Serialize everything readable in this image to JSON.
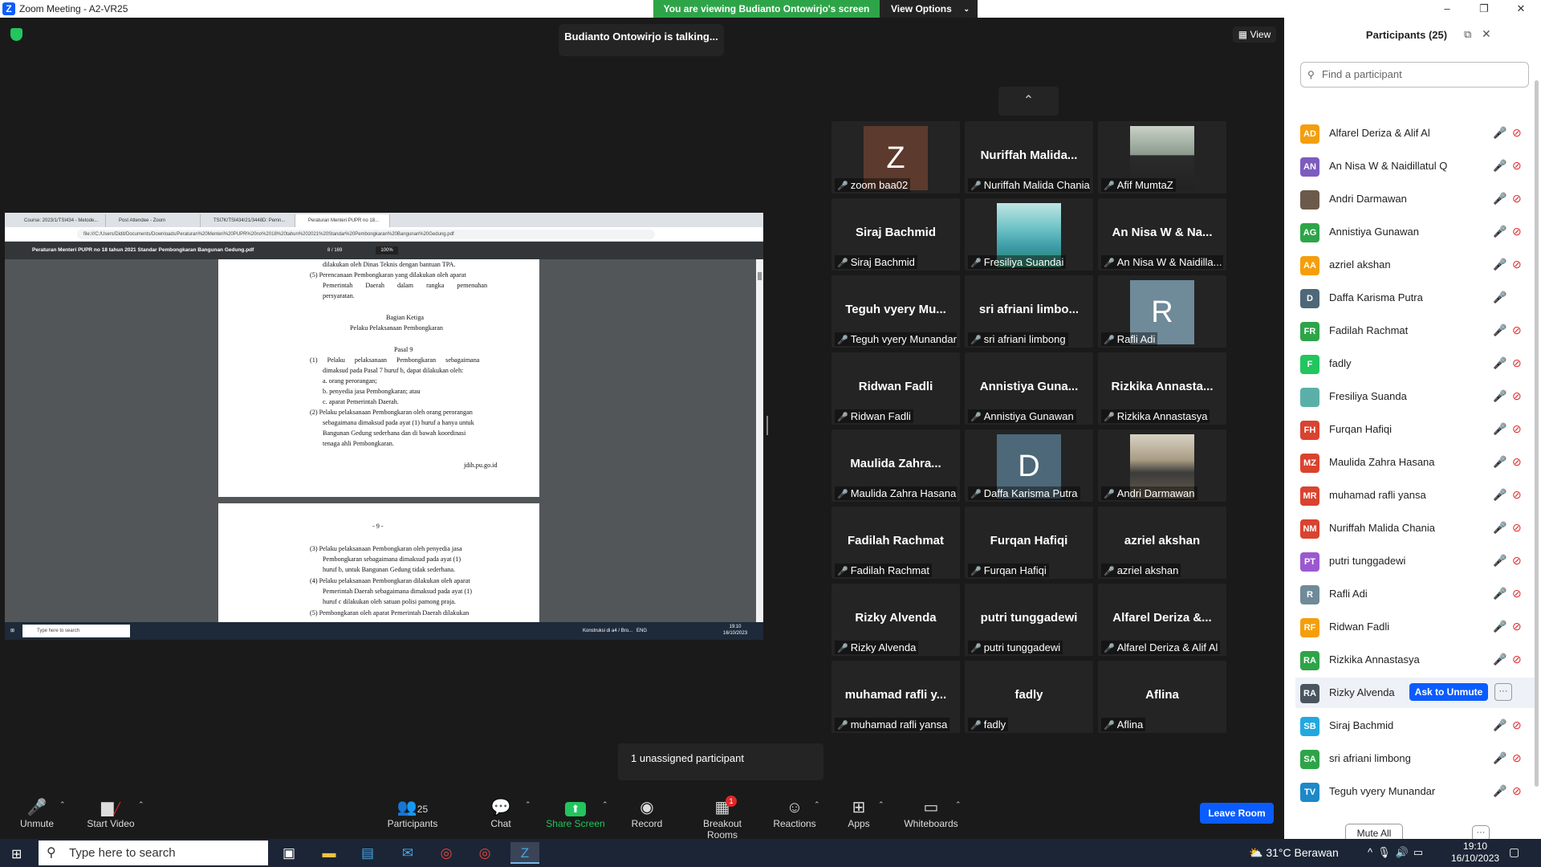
{
  "window": {
    "app_title": "Zoom Meeting - A2-VR25",
    "minimize": "–",
    "maximize": "❐",
    "close": "✕"
  },
  "banner": {
    "viewing": "You are viewing Budianto Ontowirjo's screen",
    "view_options": "View Options"
  },
  "talking": "Budianto Ontowirjo is talking...",
  "view_button": "View",
  "shared_screen": {
    "tabs": [
      "Course: 2023/1/TSI434 - Metode...",
      "Post Attendee - Zoom",
      "TSI7K/TSI434/21/3448D: Pemn...",
      "Peraturan Menteri PUPR no 18..."
    ],
    "url": "file:///C:/Users/Didit/Documents/Downloads/Peraturan%20Menteri%20PUPR%20no%2018%20tahun%202021%20Standar%20Pembongkaran%20Bangunan%20Gedung.pdf",
    "pdf_title": "Peraturan Menteri PUPR no 18 tahun 2021 Standar Pembongkaran Bangunan Gedung.pdf",
    "page_current": "8",
    "page_total": "/ 169",
    "zoom": "100%",
    "page1_lines": [
      "dilakukan oleh Dinas Teknis dengan bantuan TPA.",
      "(5)  Perencanaan Pembongkaran yang dilakukan oleh aparat",
      "Pemerintah Daerah dalam rangka pemenuhan",
      "persyaratan.",
      "Bagian Ketiga",
      "Pelaku Pelaksanaan Pembongkaran",
      "Pasal 9",
      "(1)  Pelaku pelaksanaan Pembongkaran sebagaimana",
      "dimaksud pada Pasal 7 huruf b, dapat dilakukan oleh:",
      "a.  orang perorangan;",
      "b.  penyedia jasa Pembongkaran; atau",
      "c.  aparat Pemerintah Daerah.",
      "(2)  Pelaku pelaksanaan Pembongkaran oleh orang perorangan",
      "sebagaimana dimaksud pada ayat (1) huruf a hanya untuk",
      "Bangunan Gedung sederhana dan di bawah koordinasi",
      "tenaga ahli Pembongkaran.",
      "jdih.pu.go.id"
    ],
    "page2_lines": [
      "- 9 -",
      "(3)  Pelaku pelaksanaan Pembongkaran oleh penyedia jasa",
      "Pembongkaran sebagaimana dimaksud pada ayat (1)",
      "huruf b, untuk Bangunan Gedung tidak sederhana.",
      "(4)  Pelaku pelaksanaan Pembongkaran dilakukan oleh aparat",
      "Pemerintah Daerah sebagaimana dimaksud pada ayat (1)",
      "huruf c dilakukan oleh satuan polisi pamong praja.",
      "(5)  Pembongkaran oleh aparat Pemerintah Daerah dilakukan"
    ],
    "inner_search": "Type here to search",
    "inner_tray": "Konstruksi di a4 / Bro...",
    "inner_lang": "ENG",
    "inner_time": "19:10",
    "inner_date": "16/10/2023"
  },
  "gallery": [
    {
      "big": "",
      "avatar": "Z",
      "avatar_color": "#5c3a2e",
      "label": "zoom baa02"
    },
    {
      "big": "Nuriffah Malida...",
      "label": "Nuriffah Malida Chania"
    },
    {
      "big": "",
      "photo": "person",
      "label": "Afif MumtaZ"
    },
    {
      "big": "Siraj Bachmid",
      "label": "Siraj Bachmid"
    },
    {
      "big": "",
      "photo": "waterfall",
      "label": "Fresiliya Suandai"
    },
    {
      "big": "An Nisa W & Na...",
      "label": "An Nisa W & Naidilla..."
    },
    {
      "big": "Teguh vyery Mu...",
      "label": "Teguh vyery Munandar"
    },
    {
      "big": "sri afriani limbo...",
      "label": "sri afriani limbong"
    },
    {
      "big": "",
      "avatar": "R",
      "avatar_color": "#6f8a99",
      "label": "Rafli Adi"
    },
    {
      "big": "Ridwan Fadli",
      "label": "Ridwan Fadli"
    },
    {
      "big": "Annistiya Guna...",
      "label": "Annistiya Gunawan"
    },
    {
      "big": "Rizkika Annasta...",
      "label": "Rizkika Annastasya"
    },
    {
      "big": "Maulida Zahra...",
      "label": "Maulida Zahra Hasana"
    },
    {
      "big": "",
      "avatar": "D",
      "avatar_color": "#4d6878",
      "label": "Daffa Karisma Putra"
    },
    {
      "big": "",
      "photo": "outdoor",
      "label": "Andri Darmawan"
    },
    {
      "big": "Fadilah Rachmat",
      "label": "Fadilah Rachmat"
    },
    {
      "big": "Furqan Hafiqi",
      "label": "Furqan Hafiqi"
    },
    {
      "big": "azriel akshan",
      "label": "azriel akshan"
    },
    {
      "big": "Rizky Alvenda",
      "label": "Rizky Alvenda"
    },
    {
      "big": "putri tunggadewi",
      "label": "putri tunggadewi"
    },
    {
      "big": "Alfarel Deriza &...",
      "label": "Alfarel Deriza & Alif Al"
    },
    {
      "big": "muhamad rafli y...",
      "label": "muhamad rafli yansa"
    },
    {
      "big": "fadly",
      "label": "fadly"
    },
    {
      "big": "Aflina",
      "label": "Aflina"
    }
  ],
  "unassigned": "1 unassigned participant",
  "toolbar": {
    "unmute": "Unmute",
    "start_video": "Start Video",
    "participants": "Participants",
    "participants_count": "25",
    "chat": "Chat",
    "share_screen": "Share Screen",
    "record": "Record",
    "breakout_rooms": "Breakout Rooms",
    "breakout_badge": "1",
    "reactions": "Reactions",
    "apps": "Apps",
    "whiteboards": "Whiteboards",
    "leave_room": "Leave Room"
  },
  "panel": {
    "title": "Participants (25)",
    "search_placeholder": "Find a participant",
    "mute_all": "Mute All",
    "ask_to_unmute": "Ask to Unmute",
    "participants": [
      {
        "initials": "AD",
        "color": "#f59e0b",
        "name": "Alfarel Deriza & Alif Al",
        "video_off": true
      },
      {
        "initials": "AN",
        "color": "#7c5cbf",
        "name": "An Nisa W & Naidillatul Q",
        "video_off": true
      },
      {
        "initials": "",
        "color": "#6b5a4a",
        "name": "Andri Darmawan",
        "video_off": true
      },
      {
        "initials": "AG",
        "color": "#2ea449",
        "name": "Annistiya Gunawan",
        "video_off": true
      },
      {
        "initials": "AA",
        "color": "#f59e0b",
        "name": "azriel akshan",
        "video_off": true
      },
      {
        "initials": "D",
        "color": "#4d6878",
        "name": "Daffa Karisma Putra",
        "video_off": false
      },
      {
        "initials": "FR",
        "color": "#2ea449",
        "name": "Fadilah Rachmat",
        "video_off": true
      },
      {
        "initials": "F",
        "color": "#22c55e",
        "name": "fadly",
        "video_off": true
      },
      {
        "initials": "",
        "color": "#5ab0a8",
        "name": "Fresiliya Suanda",
        "video_off": true
      },
      {
        "initials": "FH",
        "color": "#d9432f",
        "name": "Furqan Hafiqi",
        "video_off": true
      },
      {
        "initials": "MZ",
        "color": "#d9432f",
        "name": "Maulida Zahra Hasana",
        "video_off": true
      },
      {
        "initials": "MR",
        "color": "#d9432f",
        "name": "muhamad rafli yansa",
        "video_off": true
      },
      {
        "initials": "NM",
        "color": "#d9432f",
        "name": "Nuriffah Malida Chania",
        "video_off": true
      },
      {
        "initials": "PT",
        "color": "#9b59d0",
        "name": "putri tunggadewi",
        "video_off": true
      },
      {
        "initials": "R",
        "color": "#6f8a99",
        "name": "Rafli Adi",
        "video_off": true
      },
      {
        "initials": "RF",
        "color": "#f59e0b",
        "name": "Ridwan Fadli",
        "video_off": true
      },
      {
        "initials": "RA",
        "color": "#2ea449",
        "name": "Rizkika Annastasya",
        "video_off": true
      },
      {
        "initials": "RA",
        "color": "#4a5560",
        "name": "Rizky Alvenda",
        "video_off": true,
        "hovered": true
      },
      {
        "initials": "SB",
        "color": "#22a8e0",
        "name": "Siraj Bachmid",
        "video_off": true
      },
      {
        "initials": "SA",
        "color": "#2ea449",
        "name": "sri afriani limbong",
        "video_off": true
      },
      {
        "initials": "TV",
        "color": "#1e88c8",
        "name": "Teguh vyery Munandar",
        "video_off": true
      }
    ]
  },
  "taskbar": {
    "search": "Type here to search",
    "weather": "31°C  Berawan",
    "time": "19:10",
    "date": "16/10/2023"
  },
  "colors": {
    "zoom_blue": "#0b5cff",
    "green": "#2ea449",
    "muted_red": "#e02828",
    "tile_bg": "#242424"
  }
}
